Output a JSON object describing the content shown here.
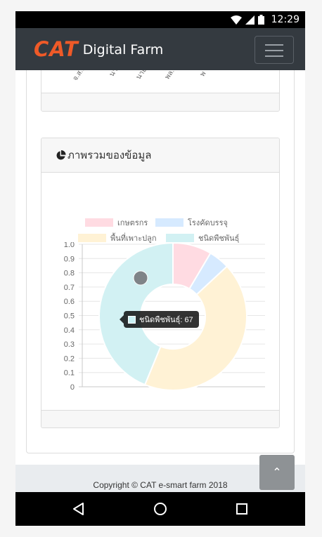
{
  "status_bar": {
    "time": "12:29"
  },
  "navbar": {
    "brand_logo": "CAT",
    "brand_name": "Digital Farm"
  },
  "bar_chart_partial": {
    "x_labels": [
      "จ.ส.ต. ย",
      "นายิ",
      "นายเจ",
      "พล.อ",
      "พ"
    ]
  },
  "overview_card": {
    "title": "ภาพรวมของข้อมูล",
    "icon": "pie-chart-icon"
  },
  "chart_data": {
    "type": "pie",
    "variant": "doughnut",
    "categories": [
      "เกษตรกร",
      "โรงคัดบรรจุ",
      "พื้นที่เพาะปลูก",
      "ชนิดพืชพันธุ์"
    ],
    "values": [
      13,
      7,
      66,
      67
    ],
    "colors": [
      "#ffdbe2",
      "#d6eaff",
      "#fff2d5",
      "#d2f1f3"
    ],
    "legend_position": "top",
    "yaxis_ticks": [
      "1.0",
      "0.9",
      "0.8",
      "0.7",
      "0.6",
      "0.5",
      "0.4",
      "0.3",
      "0.2",
      "0.1",
      "0"
    ],
    "ylim": [
      0,
      1
    ],
    "grid": true,
    "tooltip": {
      "label": "ชนิดพืชพันธุ์: 67"
    }
  },
  "footer": {
    "copyright": "Copyright © CAT e-smart farm 2018"
  },
  "scroll_top": {
    "icon": "chevron-up-icon",
    "label": "⌃"
  },
  "colors": {
    "brand_orange": "#ef5a28",
    "navbar": "#343a40",
    "footer": "#e9ecef"
  }
}
